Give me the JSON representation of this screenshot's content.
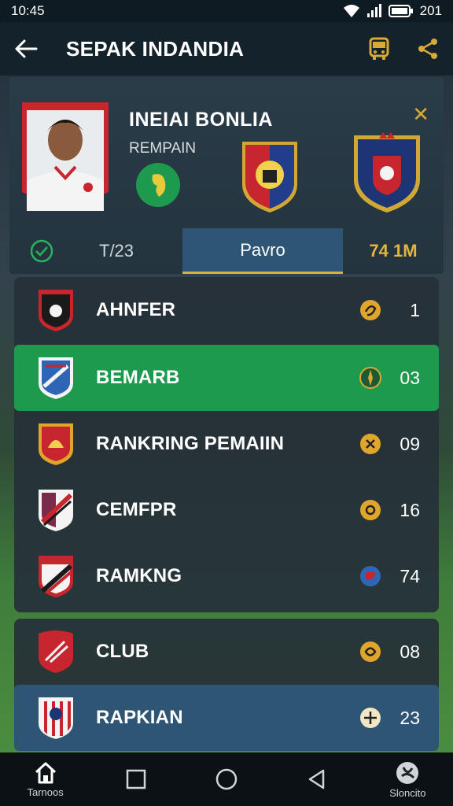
{
  "status": {
    "time": "10:45",
    "battery": "201"
  },
  "appbar": {
    "title": "SEPAK INDANDIA"
  },
  "hero": {
    "player_name": "INEIAI BONLIA",
    "player_sub": "REMPAIN",
    "tabs": [
      {
        "label": "T/23"
      },
      {
        "label": "Pavro"
      },
      {
        "label": "74 1M"
      }
    ]
  },
  "rows": [
    {
      "name": "AHNFER",
      "value": "1"
    },
    {
      "name": "BEMARB",
      "value": "03"
    },
    {
      "name": "RANKRING PEMAIIN",
      "value": "09"
    },
    {
      "name": "CEMFPR",
      "value": "16"
    },
    {
      "name": "RAMKNG",
      "value": "74"
    },
    {
      "name": "CLUB",
      "value": "08"
    },
    {
      "name": "RAPKIAN",
      "value": "23"
    }
  ],
  "navbar": {
    "home_label": "Tarnoos",
    "right_label": "Sloncito"
  },
  "colors": {
    "accent": "#1e9a4f",
    "selected": "#2e5674",
    "gold": "#d8b13a"
  }
}
